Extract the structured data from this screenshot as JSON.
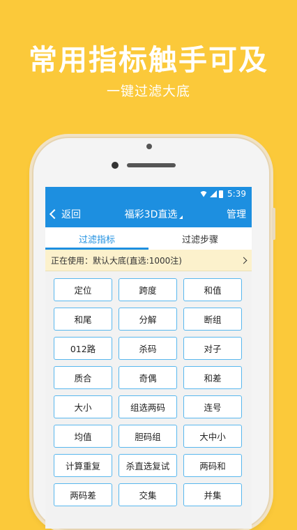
{
  "promo": {
    "headline": "常用指标触手可及",
    "subline": "一键过滤大底"
  },
  "statusbar": {
    "time": "5:39"
  },
  "topbar": {
    "back_label": "返回",
    "title": "福彩3D直选",
    "manage_label": "管理"
  },
  "tabs": [
    {
      "label": "过滤指标",
      "active": true
    },
    {
      "label": "过滤步骤",
      "active": false
    }
  ],
  "notice": {
    "text": "正在使用：默认大底(直选:1000注)"
  },
  "filters": [
    "定位",
    "跨度",
    "和值",
    "和尾",
    "分解",
    "断组",
    "012路",
    "杀码",
    "对子",
    "质合",
    "奇偶",
    "和差",
    "大小",
    "组选两码",
    "连号",
    "均值",
    "胆码组",
    "大中小",
    "计算重复",
    "杀直选复试",
    "两码和",
    "两码差",
    "交集",
    "并集"
  ],
  "colors": {
    "background": "#fbc93a",
    "accent": "#1d8fe0",
    "cell_border": "#58b7ee",
    "notice_bg": "#fcf1cc"
  }
}
